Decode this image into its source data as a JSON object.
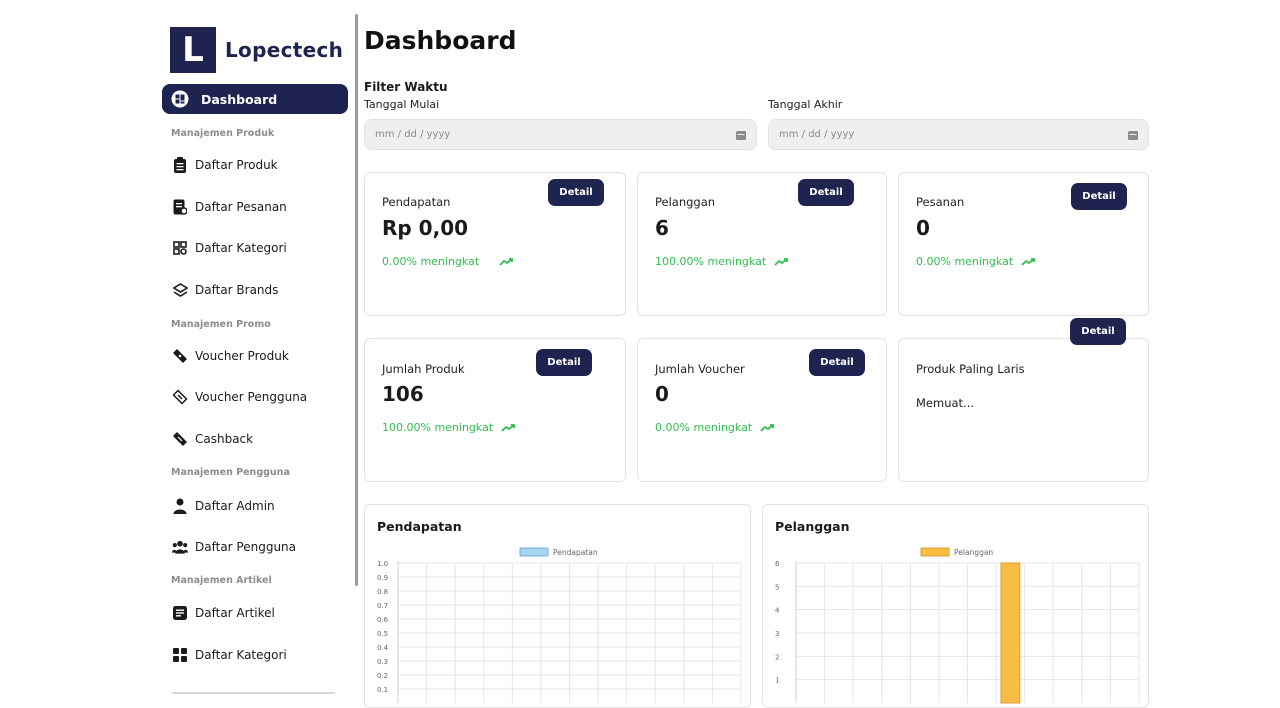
{
  "brand": {
    "logo_letter": "L",
    "name": "Lopectech"
  },
  "sidebar": {
    "active": {
      "label": "Dashboard",
      "icon": "dashboard-icon"
    },
    "sections": [
      {
        "title": "Manajemen Produk",
        "items": [
          {
            "label": "Daftar Produk",
            "icon": "clipboard-list-icon"
          },
          {
            "label": "Daftar Pesanan",
            "icon": "receipt-icon"
          },
          {
            "label": "Daftar Kategori",
            "icon": "grid-icon"
          },
          {
            "label": "Daftar Brands",
            "icon": "layers-icon"
          }
        ]
      },
      {
        "title": "Manajemen Promo",
        "items": [
          {
            "label": "Voucher Produk",
            "icon": "ticket-icon"
          },
          {
            "label": "Voucher Pengguna",
            "icon": "ticket-outline-icon"
          },
          {
            "label": "Cashback",
            "icon": "ticket-icon"
          }
        ]
      },
      {
        "title": "Manajemen Pengguna",
        "items": [
          {
            "label": "Daftar Admin",
            "icon": "user-icon"
          },
          {
            "label": "Daftar Pengguna",
            "icon": "users-icon"
          }
        ]
      },
      {
        "title": "Manajemen Artikel",
        "items": [
          {
            "label": "Daftar Artikel",
            "icon": "article-icon"
          },
          {
            "label": "Daftar Kategori",
            "icon": "grid-solid-icon"
          }
        ]
      }
    ]
  },
  "main": {
    "title": "Dashboard",
    "filter": {
      "title": "Filter Waktu",
      "start_label": "Tanggal Mulai",
      "start_placeholder": "mm / dd / yyyy",
      "end_label": "Tanggal Akhir",
      "end_placeholder": "mm / dd / yyyy"
    },
    "cards": [
      {
        "title": "Pendapatan",
        "value": "Rp 0,00",
        "trend": "0.00% meningkat",
        "button": "Detail"
      },
      {
        "title": "Pelanggan",
        "value": "6",
        "trend": "100.00% meningkat",
        "button": "Detail"
      },
      {
        "title": "Pesanan",
        "value": "0",
        "trend": "0.00% meningkat",
        "button": "Detail"
      },
      {
        "title": "Jumlah Produk",
        "value": "106",
        "trend": "100.00% meningkat",
        "button": "Detail"
      },
      {
        "title": "Jumlah Voucher",
        "value": "0",
        "trend": "0.00% meningkat",
        "button": "Detail"
      },
      {
        "title": "Produk Paling Laris",
        "subtitle": "Memuat...",
        "button": "Detail"
      }
    ],
    "colors": {
      "primary": "#1e2350",
      "trend_green": "#2fbf4e",
      "revenue_series": "#a8d3f0",
      "customer_series": "#f9bd45"
    }
  },
  "chart_data": [
    {
      "type": "bar",
      "title": "Pendapatan",
      "series": [
        {
          "name": "Pendapatan",
          "values": []
        }
      ],
      "y_ticks": [
        "1.0",
        "0.9",
        "0.8",
        "0.7",
        "0.6",
        "0.5",
        "0.4",
        "0.3",
        "0.2",
        "0.1"
      ],
      "ylim": [
        0,
        1.0
      ],
      "grid": true,
      "legend": "top"
    },
    {
      "type": "bar",
      "title": "Pelanggan",
      "series": [
        {
          "name": "Pelanggan",
          "values": [
            0,
            0,
            0,
            0,
            0,
            0,
            0,
            6,
            0,
            0,
            0,
            0
          ]
        }
      ],
      "y_ticks": [
        "6",
        "5",
        "4",
        "3",
        "2",
        "1"
      ],
      "ylim": [
        0,
        6
      ],
      "grid": true,
      "legend": "top"
    }
  ]
}
